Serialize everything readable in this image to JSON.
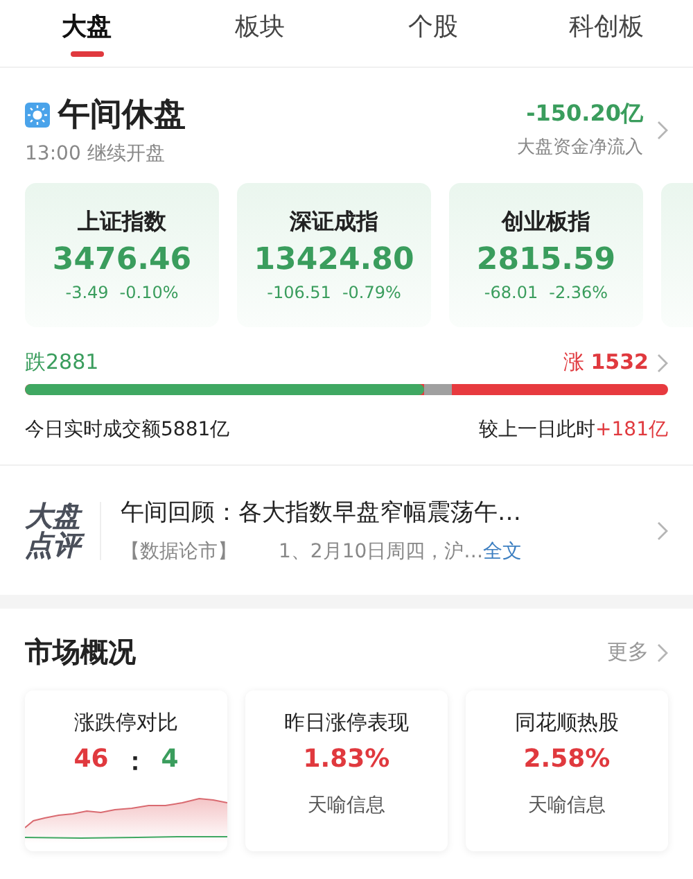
{
  "tabs": [
    {
      "label": "大盘",
      "selected": true
    },
    {
      "label": "板块",
      "selected": false
    },
    {
      "label": "个股",
      "selected": false
    },
    {
      "label": "科创板",
      "selected": false
    }
  ],
  "status": {
    "title": "午间休盘",
    "subtitle": "13:00 继续开盘",
    "flow_value": "-150.20亿",
    "flow_label": "大盘资金净流入"
  },
  "indices": [
    {
      "name": "上证指数",
      "value": "3476.46",
      "change": "-3.49",
      "percent": "-0.10%"
    },
    {
      "name": "深证成指",
      "value": "13424.80",
      "change": "-106.51",
      "percent": "-0.79%"
    },
    {
      "name": "创业板指",
      "value": "2815.59",
      "change": "-68.01",
      "percent": "-2.36%"
    }
  ],
  "breadth": {
    "fall_label": "跌",
    "fall_count": "2881",
    "rise_label": "涨",
    "rise_count": "1532",
    "level": 0.62
  },
  "turnover": {
    "label": "今日实时成交额5881亿",
    "compare_label": "较上一日此时",
    "compare_value": "+181亿"
  },
  "news": {
    "logo_top": "大盘",
    "logo_bottom": "点评",
    "headline": "午间回顾：各大指数早盘窄幅震荡午…",
    "source": "【数据论市】",
    "snippet": "1、2月10日周四，沪…",
    "link": "全文"
  },
  "market": {
    "title": "市场概况",
    "more": "更多",
    "cards": [
      {
        "kind": "ratio",
        "title": "涨跌停对比",
        "up": "46",
        "separator": "：",
        "down": "4"
      },
      {
        "kind": "percent",
        "title": "昨日涨停表现",
        "value": "1.83%",
        "caption": "天喻信息"
      },
      {
        "kind": "percent",
        "title": "同花顺热股",
        "value": "2.58%",
        "caption": "天喻信息"
      }
    ]
  }
}
